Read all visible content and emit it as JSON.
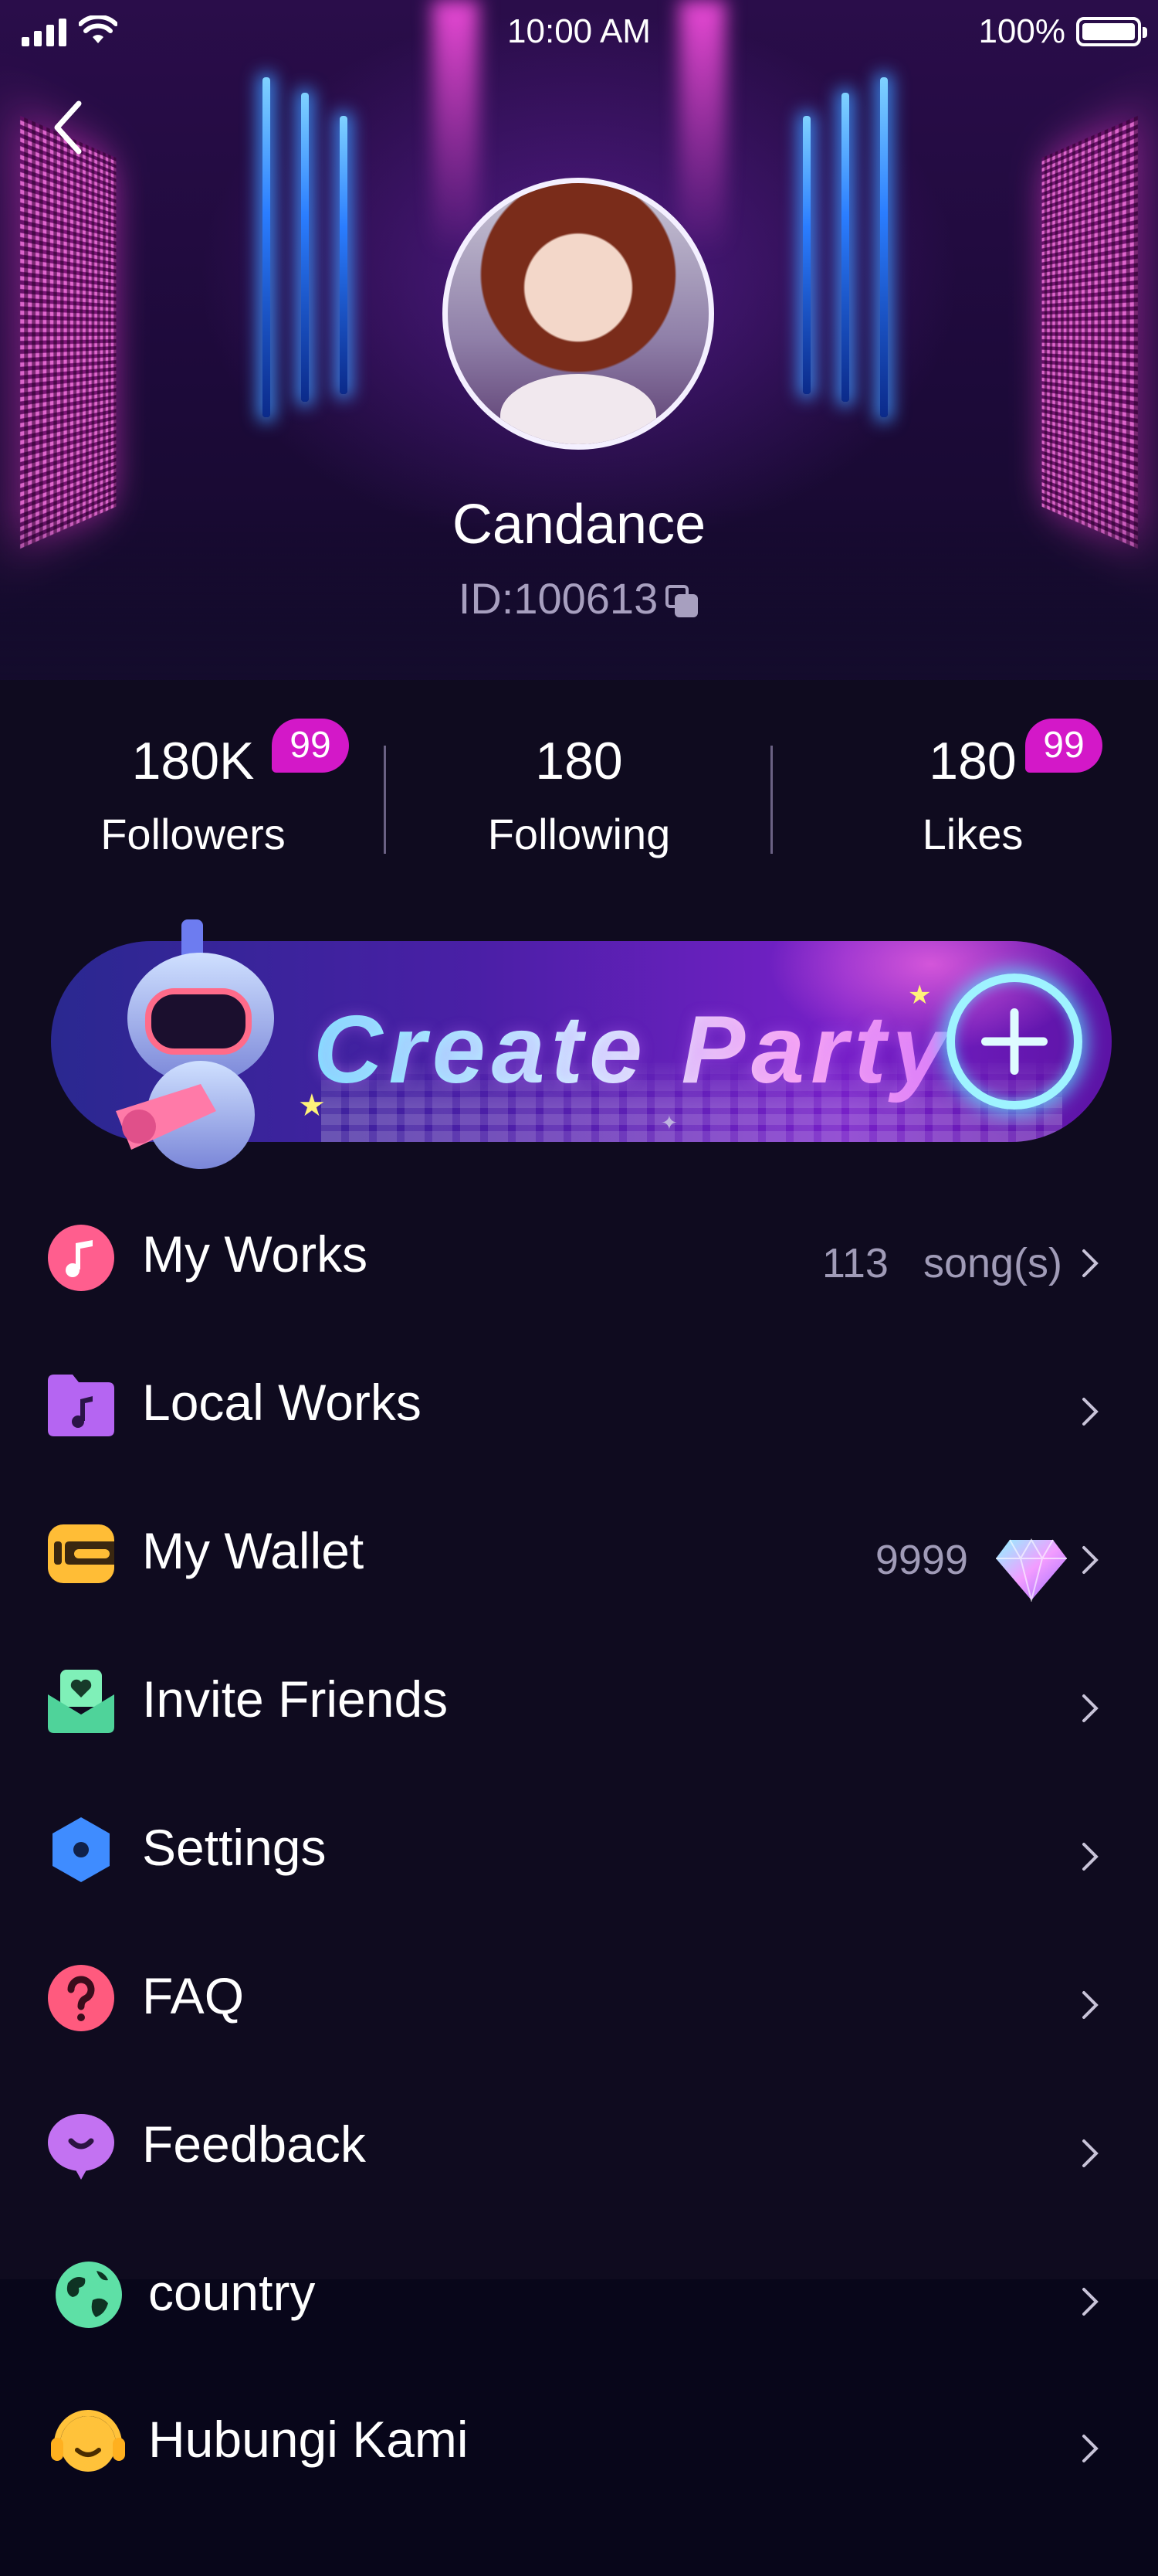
{
  "status_bar": {
    "time": "10:00 AM",
    "battery": "100%"
  },
  "profile": {
    "name": "Candance",
    "id": "ID:100613"
  },
  "stats": [
    {
      "value": "180K",
      "label": "Followers",
      "badge": "99"
    },
    {
      "value": "180",
      "label": "Following",
      "badge": null
    },
    {
      "value": "180",
      "label": "Likes",
      "badge": "99"
    }
  ],
  "party_banner": {
    "label": "Create Party"
  },
  "menu": [
    {
      "label": "My Works",
      "value_count": "113",
      "value_unit": "song(s)",
      "icon": "music-note-icon"
    },
    {
      "label": "Local Works",
      "value": "",
      "icon": "music-folder-icon"
    },
    {
      "label": "My Wallet",
      "value": "9999",
      "icon": "wallet-icon"
    },
    {
      "label": "Invite Friends",
      "value": "",
      "icon": "invite-heart-icon"
    },
    {
      "label": "Settings",
      "value": "",
      "icon": "settings-hexagon-icon"
    },
    {
      "label": "FAQ",
      "value": "",
      "icon": "question-icon"
    },
    {
      "label": "Feedback",
      "value": "",
      "icon": "feedback-bubble-icon"
    },
    {
      "label": "country",
      "value": "",
      "icon": "globe-icon"
    },
    {
      "label": "Hubungi Kami",
      "value": "",
      "icon": "headset-icon"
    }
  ],
  "colors": {
    "background": "#0f0b1f",
    "badge": "#d318c8",
    "muted_text": "#a09bb7"
  }
}
